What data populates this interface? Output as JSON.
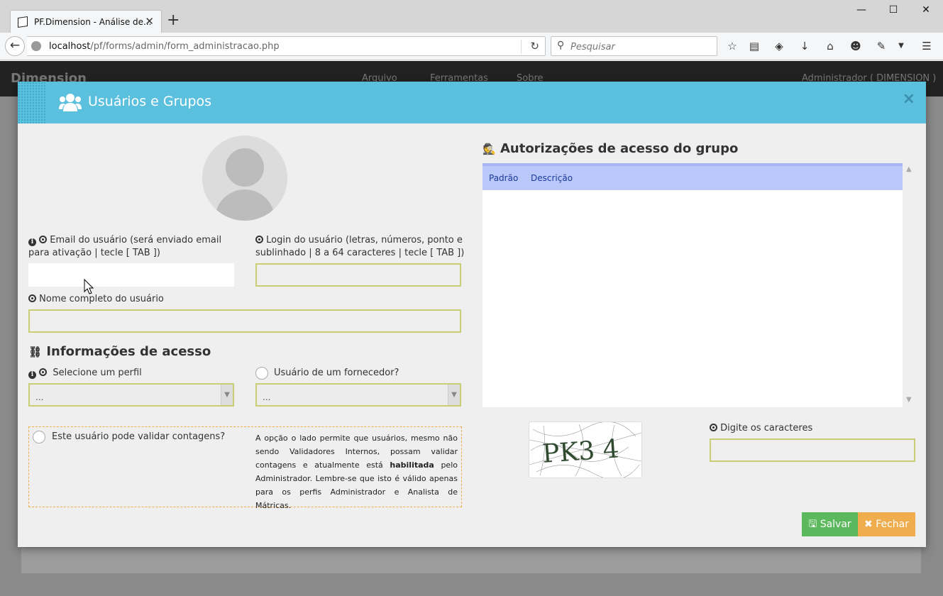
{
  "browser": {
    "tab_title": "PF.Dimension - Análise de...",
    "tab_close": "✕",
    "new_tab": "+",
    "url_host": "localhost",
    "url_path": "/pf/forms/admin/form_administracao.php",
    "search_placeholder": "Pesquisar",
    "window_controls": {
      "minimize": "—",
      "maximize": "☐",
      "close": "✕"
    }
  },
  "app": {
    "brand": "Dimension",
    "menu": [
      "Arquivo",
      "Ferramentas",
      "Sobre"
    ],
    "user": "Administrador ( DIMENSION )"
  },
  "modal": {
    "title": "Usuários e Grupos",
    "close": "×",
    "email_label_1": "Email do usuário (será enviado email",
    "email_label_2": "para ativação | tecle [ TAB ])",
    "email_value": "",
    "login_label_1": "Login do usuário (letras, números, ponto e",
    "login_label_2": "sublinhado | 8 a 64 caracteres | tecle [ TAB ])",
    "login_value": "",
    "name_label": "Nome completo do usuário",
    "name_value": "",
    "access_title": "Informações de acesso",
    "profile_label": "Selecione um perfil",
    "profile_value": "...",
    "supplier_label": "Usuário de um fornecedor?",
    "supplier_value": "...",
    "validate_label": "Este usuário pode validar contagens?",
    "validate_desc_1": "A opção o lado permite que usuários, mesmo não sendo Validadores Internos, possam validar contagens e atualmente está",
    "validate_desc_bold": "habilitada",
    "validate_desc_2": "pelo Administrador. Lembre-se que isto é válido apenas para os perfis Administrador e Analista de Mátricas.",
    "perm_title": "Autorizações de acesso do grupo",
    "perm_columns": [
      "Padrão",
      "Descrição"
    ],
    "captcha_text": "PK3 4",
    "captcha_label": "Digite os caracteres",
    "captcha_value": "",
    "save_label": "Salvar",
    "close_label": "Fechar"
  },
  "colors": {
    "header": "#5bc0de",
    "save": "#5cb85c",
    "close": "#f0ad4e",
    "input_border": "#c9ce73",
    "table_header": "#bac7f9"
  }
}
